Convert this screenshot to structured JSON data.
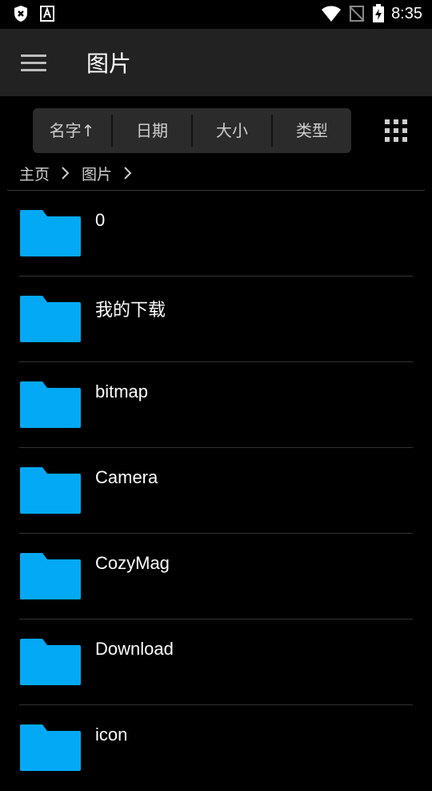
{
  "status_bar": {
    "time": "8:35",
    "icons": [
      "shield-x-icon",
      "font-a-icon",
      "wifi-icon",
      "no-sim-icon",
      "battery-charging-icon"
    ]
  },
  "app_bar": {
    "title": "图片",
    "menu_icon": "menu-icon"
  },
  "sort_bar": {
    "items": [
      {
        "label": "名字↑"
      },
      {
        "label": "日期"
      },
      {
        "label": "大小"
      },
      {
        "label": "类型"
      }
    ],
    "view_toggle_icon": "grid-view-icon"
  },
  "breadcrumb": {
    "items": [
      {
        "label": "主页"
      },
      {
        "label": "图片"
      }
    ]
  },
  "files": [
    {
      "name": "0"
    },
    {
      "name": "我的下载"
    },
    {
      "name": "bitmap"
    },
    {
      "name": "Camera"
    },
    {
      "name": "CozyMag"
    },
    {
      "name": "Download"
    },
    {
      "name": "icon"
    }
  ],
  "colors": {
    "folder": "#03A9F4",
    "background": "#000000",
    "app_bar": "#222222"
  }
}
